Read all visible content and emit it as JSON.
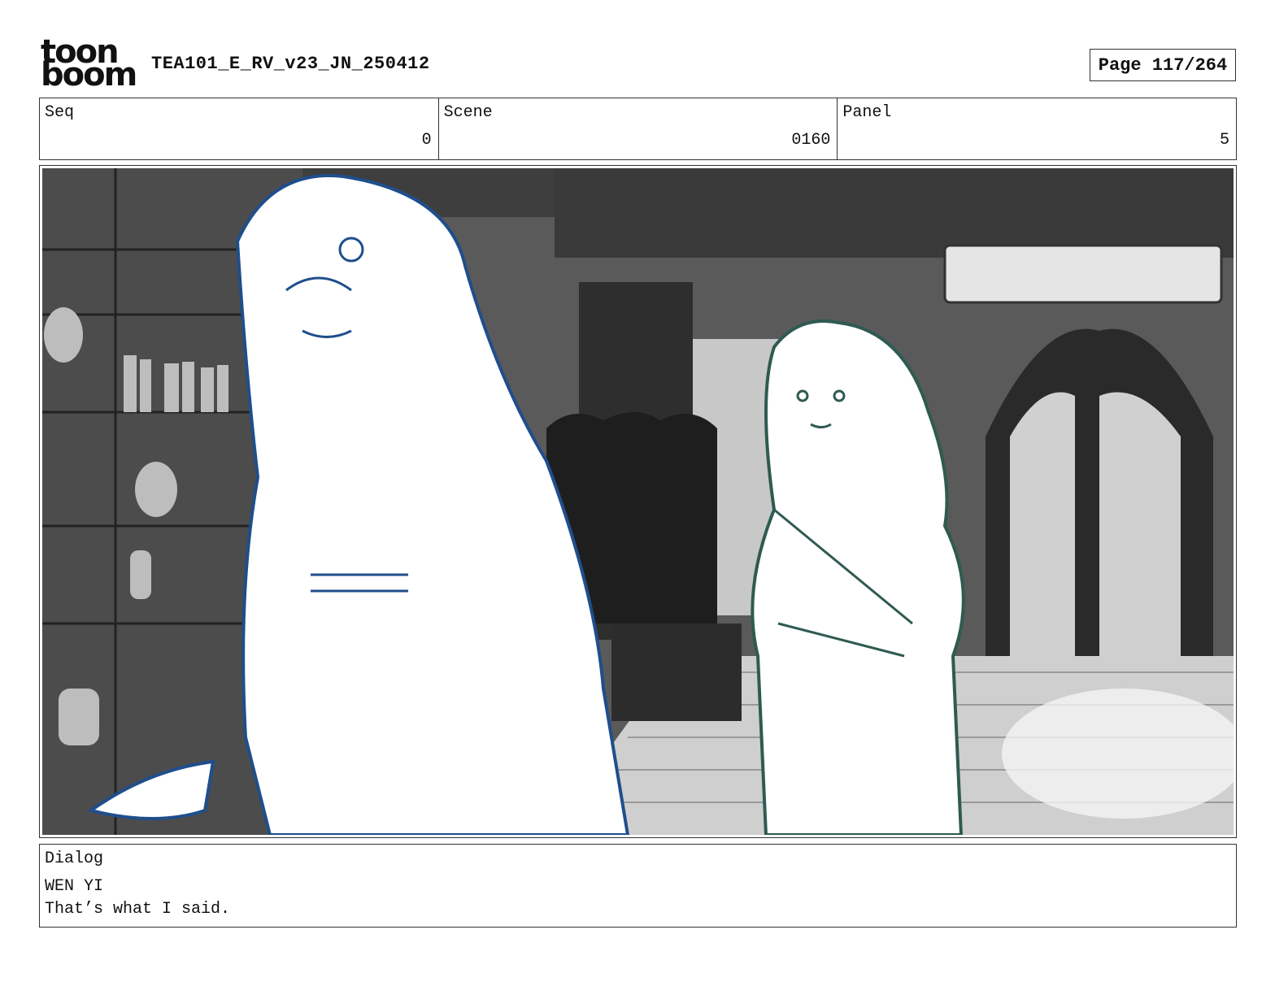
{
  "header": {
    "logo": {
      "line1": "toon",
      "line2": "boom"
    },
    "title": "TEA101_E_RV_v23_JN_250412",
    "page": "Page 117/264"
  },
  "info": {
    "seq": {
      "label": "Seq",
      "value": "0"
    },
    "scene": {
      "label": "Scene",
      "value": "0160"
    },
    "panel": {
      "label": "Panel",
      "value": "5"
    }
  },
  "dialog": {
    "label": "Dialog",
    "speaker": "WEN YI",
    "line": "That’s what I said."
  },
  "colors": {
    "blue_character": "#1f4e8c",
    "teal_character": "#2f5a52",
    "background_dark": "#4a4a4a",
    "background_light": "#d9d9d9"
  }
}
